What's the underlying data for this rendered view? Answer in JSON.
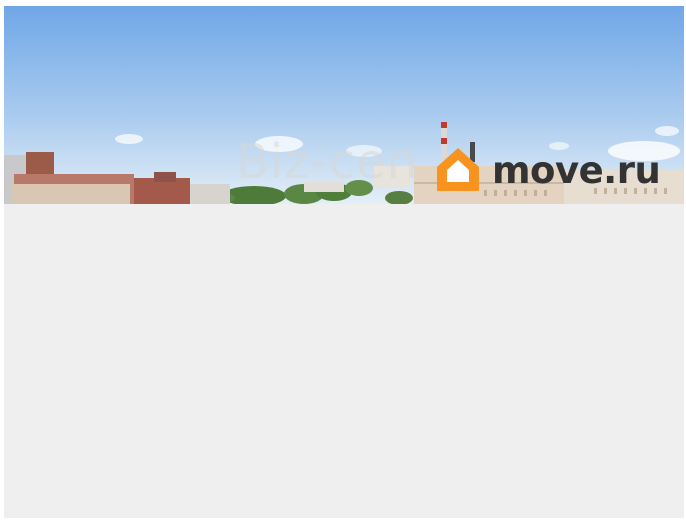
{
  "watermark": {
    "text": "Biz-cen"
  },
  "brand": {
    "name": "move.ru",
    "accent_color": "#f7931e",
    "text_color": "#333333"
  },
  "photo": {
    "subject": "city-skyline-photo"
  },
  "colors": {
    "sky_top": "#6fa7e6",
    "sky_bottom": "#e4eef7",
    "placeholder_bg": "#efefef"
  }
}
